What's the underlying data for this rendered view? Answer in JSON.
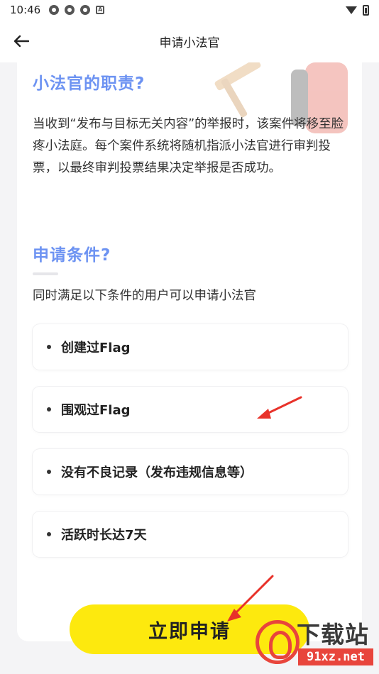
{
  "status_bar": {
    "time": "10:46",
    "icons": [
      "app-icon",
      "app-icon",
      "app-icon",
      "a-badge-icon"
    ],
    "a_badge": "A"
  },
  "header": {
    "back_icon": "arrow-left-icon",
    "title": "申请小法官"
  },
  "duties": {
    "title": "小法官的职责?",
    "description": "当收到“发布与目标无关内容”的举报时，该案件将移至脸疼小法庭。每个案件系统将随机指派小法官进行审判投票，以最终审判投票结果决定举报是否成功。"
  },
  "conditions": {
    "title": "申请条件?",
    "intro": "同时满足以下条件的用户可以申请小法官",
    "items": [
      {
        "label": "创建过Flag"
      },
      {
        "label": "围观过Flag"
      },
      {
        "label": "没有不良记录（发布违规信息等）"
      },
      {
        "label": "活跃时长达7天"
      }
    ]
  },
  "apply_button": {
    "label": "立即申请"
  },
  "watermark": {
    "logo_text": "9",
    "top_text": "下载站",
    "bottom_text": "91xz.net"
  },
  "colors": {
    "accent_blue": "#6d93f2",
    "button_yellow": "#fde90e",
    "annotation_red": "#e8322a",
    "background": "#f4f4f6"
  }
}
